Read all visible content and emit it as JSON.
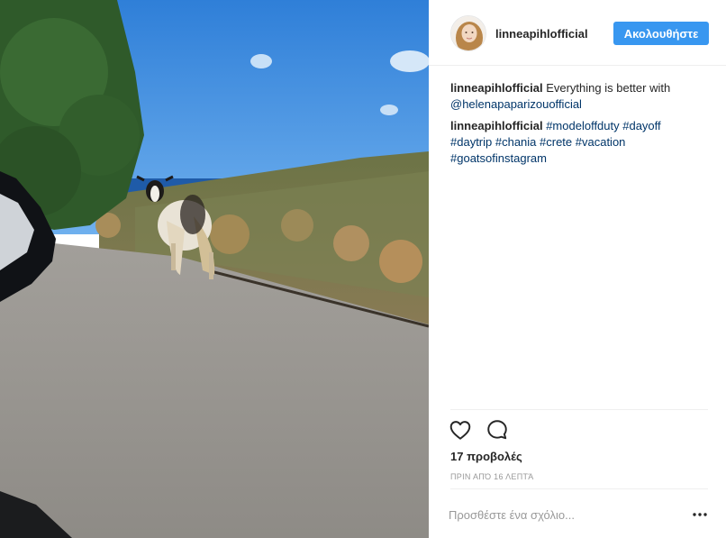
{
  "post": {
    "username": "linneapihlofficial",
    "follow_label": "Ακολουθήστε",
    "comments": [
      {
        "user": "linneapihlofficial",
        "text": "Everything is better with",
        "mention": "@helenapaparizouofficial"
      },
      {
        "user": "linneapihlofficial",
        "hashtags_line1": "#modeloffduty #dayoff",
        "hashtags_line2": "#daytrip #chania #crete #vacation",
        "hashtags_line3": "#goatsofinstagram"
      }
    ],
    "views": "17 προβολές",
    "timestamp": "ΠΡΙΝ ΑΠΌ 16 ΛΕΠΤΆ",
    "add_comment_placeholder": "Προσθέστε ένα σχόλιο...",
    "icons": {
      "like": "heart-icon",
      "comment": "comment-bubble-icon",
      "more": "more-options-icon"
    }
  },
  "colors": {
    "follow_button": "#3897f0",
    "link": "#003569",
    "muted": "#999999"
  }
}
